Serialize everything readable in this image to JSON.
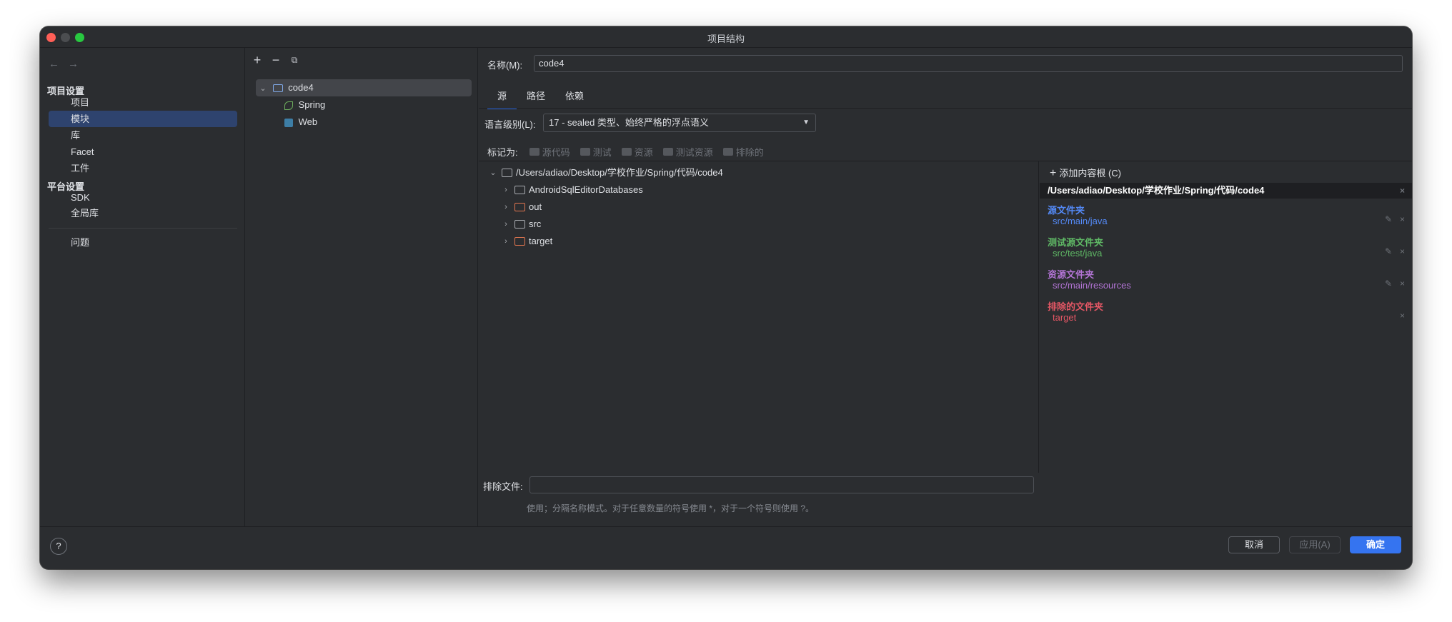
{
  "window": {
    "title": "项目结构"
  },
  "nav": {
    "project_settings_header": "项目设置",
    "platform_settings_header": "平台设置",
    "items": {
      "project": "项目",
      "modules": "模块",
      "libraries": "库",
      "facets": "Facet",
      "artifacts": "工件",
      "sdk": "SDK",
      "global_libraries": "全局库",
      "problems": "问题"
    }
  },
  "modules": {
    "root": "code4",
    "children": [
      "Spring",
      "Web"
    ]
  },
  "content": {
    "name_label": "名称(M):",
    "name_value": "code4",
    "tabs": [
      "源",
      "路径",
      "依赖"
    ],
    "language_level_label": "语言级别(L):",
    "language_level_value": "17 - sealed 类型、始终严格的浮点语义",
    "mark_as_label": "标记为:",
    "mark_buttons": [
      "源代码",
      "测试",
      "资源",
      "测试资源",
      "排除的"
    ],
    "tree": {
      "root": "/Users/adiao/Desktop/学校作业/Spring/代码/code4",
      "children": [
        "AndroidSqlEditorDatabases",
        "out",
        "src",
        "target"
      ]
    },
    "roots_panel": {
      "add_content_root": "添加内容根 (C)",
      "path": "/Users/adiao/Desktop/学校作业/Spring/代码/code4",
      "sources_header": "源文件夹",
      "sources_value": "src/main/java",
      "test_sources_header": "测试源文件夹",
      "test_sources_value": "src/test/java",
      "resources_header": "资源文件夹",
      "resources_value": "src/main/resources",
      "excluded_header": "排除的文件夹",
      "excluded_value": "target"
    },
    "exclude_files_label": "排除文件:",
    "exclude_hint": "使用；分隔名称模式。对于任意数量的符号使用 *，对于一个符号则使用 ?。"
  },
  "footer": {
    "help": "?",
    "cancel": "取消",
    "apply": "应用(A)",
    "ok": "确定"
  },
  "colors": {
    "accent": "#3574f0",
    "sources": "#548af7",
    "tests": "#5fb865",
    "resources": "#b274d4",
    "excluded": "#e55765"
  }
}
